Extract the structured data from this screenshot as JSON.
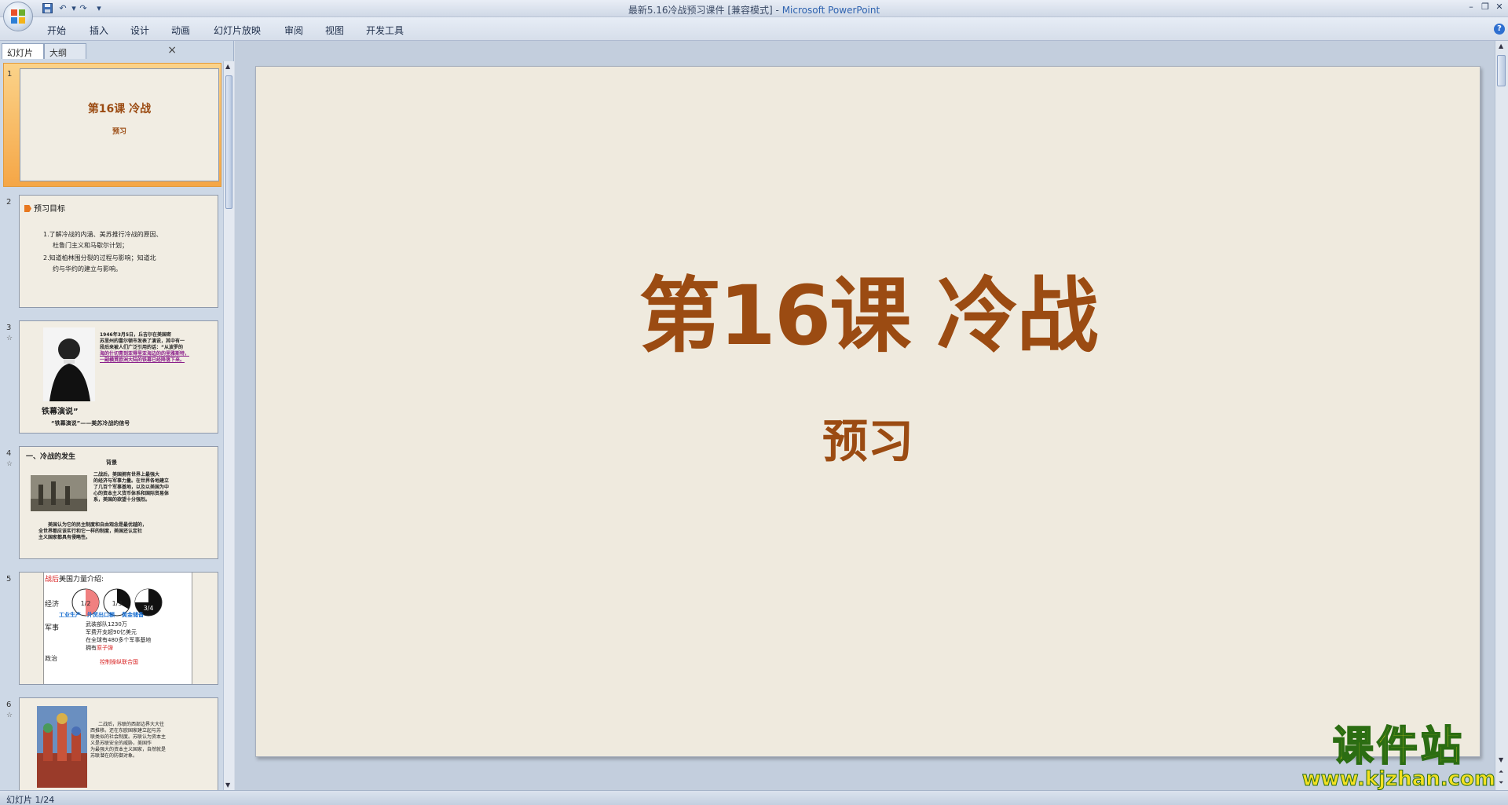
{
  "window": {
    "title": "最新5.16冷战预习课件 [兼容模式]",
    "separator": " - ",
    "app": "Microsoft PowerPoint"
  },
  "quick_access": {
    "icons": [
      "save-icon",
      "undo-icon",
      "redo-icon",
      "customize-dropdown-icon"
    ]
  },
  "ribbon": {
    "tabs": [
      "开始",
      "插入",
      "设计",
      "动画",
      "幻灯片放映",
      "审阅",
      "视图",
      "开发工具"
    ]
  },
  "panel": {
    "tab_slides": "幻灯片",
    "tab_outline": "大纲",
    "close": "×"
  },
  "thumbnails": [
    {
      "num": "1",
      "title": "第16课 冷战",
      "subtitle": "预习"
    },
    {
      "num": "2",
      "heading": "预习目标",
      "lines": [
        "1.了解冷战的内涵、美苏推行冷战的原因、",
        "杜鲁门主义和马歇尔计划；",
        "2.知道柏林围分裂的过程与影响；知道北",
        "约与华约的建立与影响。"
      ]
    },
    {
      "num": "3",
      "caption": "铁幕演说”",
      "subcaption": "“铁幕演说”——美苏冷战的信号",
      "body": [
        "1946年3月5日，丘吉尔在美国密",
        "苏里州的富尔顿市发表了演说，其中有一",
        "段后来被人们广泛引用的话：“从波罗的",
        "海的什切青到亚得里亚海边的的里雅斯特，",
        "一副横贯欧洲大陆的铁幕已经降落下来。"
      ]
    },
    {
      "num": "4",
      "heading": "一、冷战的发生",
      "label": "背景",
      "body": [
        "二战后，美国拥有世界上最强大",
        "的经济与军事力量。在世界各地建立",
        "了几百个军事基地，以及以美国为中",
        "心的资本主义货币体系和国际贸易体",
        "系，美国的欲望十分强烈。"
      ],
      "body2": [
        "美国认为它的民主制度和自由观念是最优越的，",
        "全世界都应该实行和它一样的制度，美国还认定社",
        "主义国家都具有侵略性。"
      ]
    },
    {
      "num": "5",
      "heading_red": "战后",
      "heading": "美国力量介绍:",
      "econ": "经济",
      "pies": [
        "1/2",
        "1/3",
        "3/4"
      ],
      "pie_labels": [
        "工业生产",
        "外贸出口额",
        "黄金储备"
      ],
      "military": "军事",
      "mil_lines": [
        "武装部队1230万",
        "军费开支超90亿美元",
        "在全球有480多个军事基地"
      ],
      "atom": "拥有",
      "atom_red": "原子弹",
      "politics": "政治",
      "politics_red": "控制操纵联合国"
    },
    {
      "num": "6",
      "body": [
        "二战后，苏联的西部边界大大往",
        "西推移。还在东欧国家建立起与苏",
        "联类似的社会制度。苏联认为资本主",
        "义是苏联安全的威胁，美国作",
        "为最强大的资本主义国家，自然就是",
        "苏联潜在的防御对象。"
      ]
    }
  ],
  "slide": {
    "title": "第16课 冷战",
    "subtitle": "预习"
  },
  "watermark": {
    "name": "课件站",
    "url": "www.kjzhan.com"
  },
  "status": {
    "text": "幻灯片 1/24"
  },
  "colors": {
    "title_brown": "#9b4b12",
    "slide_bg": "#efeade",
    "selection_orange": "#f5a646"
  }
}
